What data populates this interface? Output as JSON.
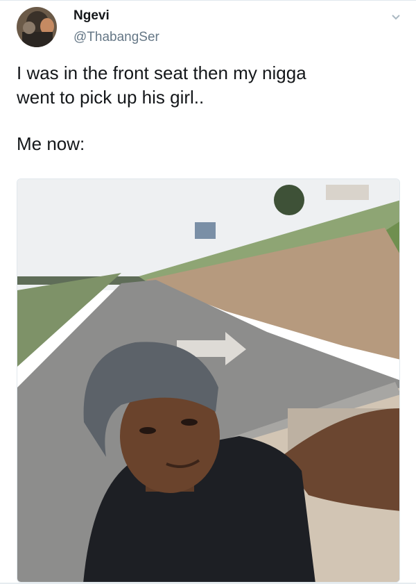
{
  "tweet": {
    "display_name": "Ngevi",
    "handle": "@ThabangSer",
    "text_line1": "I was in the front seat then my nigga",
    "text_line2": "went to pick up his girl..",
    "text_line3": "Me now:",
    "menu_icon": "chevron-down-icon",
    "avatar_icon": "profile-photo"
  },
  "colors": {
    "name": "#14171a",
    "handle": "#657786",
    "divider": "#e1e8ed"
  }
}
